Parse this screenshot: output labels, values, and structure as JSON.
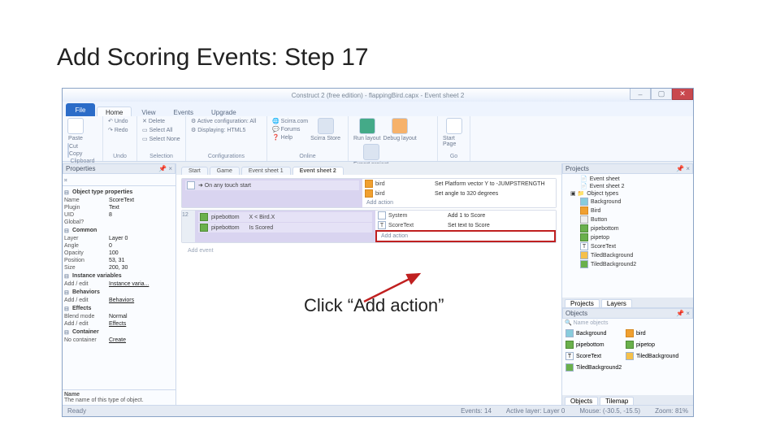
{
  "slide": {
    "title": "Add Scoring Events: Step 17",
    "annotation": "Click “Add action”"
  },
  "window": {
    "title": "Construct 2 (free edition) - flappingBird.capx - Event sheet 2",
    "file_btn": "File",
    "tabs": [
      "Home",
      "View",
      "Events",
      "Upgrade"
    ],
    "active_tab": "Home"
  },
  "ribbon": {
    "clipboard": {
      "label": "Clipboard",
      "paste": "Paste",
      "cut": "Cut",
      "copy": "Copy"
    },
    "undo": {
      "label": "Undo",
      "undo": "Undo",
      "redo": "Redo"
    },
    "selection": {
      "label": "Selection",
      "del": "Delete",
      "all": "Select All",
      "none": "Select None"
    },
    "config": {
      "label": "Configurations",
      "active": "Active configuration: All",
      "display": "Displaying: HTML5"
    },
    "online": {
      "label": "Online",
      "a": "Scirra.com",
      "b": "Forums",
      "c": "Help",
      "store": "Scirra Store"
    },
    "run": {
      "run": "Run layout",
      "debug": "Debug layout",
      "export": "Export project"
    },
    "go": {
      "label": "Go",
      "start": "Start Page"
    }
  },
  "panels": {
    "properties": {
      "title": "Properties",
      "search": "𝄪"
    },
    "projects": {
      "title": "Projects"
    },
    "layers_title": "Objects",
    "projects_tab": "Projects",
    "layers_tab": "Layers",
    "objects_tab": "Objects",
    "tilemap_tab": "Tilemap",
    "name_objects": "Name objects"
  },
  "props": {
    "sections": {
      "type": "Object type properties",
      "common": "Common",
      "instance": "Instance variables",
      "behaviors": "Behaviors",
      "effects": "Effects",
      "container": "Container"
    },
    "rows": {
      "name_k": "Name",
      "name_v": "ScoreText",
      "plugin_k": "Plugin",
      "plugin_v": "Text",
      "uid_k": "UID",
      "uid_v": "8",
      "global_k": "Global?",
      "layer_k": "Layer",
      "layer_v": "Layer 0",
      "angle_k": "Angle",
      "angle_v": "0",
      "opacity_k": "Opacity",
      "opacity_v": "100",
      "pos_k": "Position",
      "pos_v": "53, 31",
      "size_k": "Size",
      "size_v": "200, 30",
      "ivar": "Add / edit",
      "ivar_v": "Instance varia...",
      "beh": "Add / edit",
      "beh_v": "Behaviors",
      "blend_k": "Blend mode",
      "blend_v": "Normal",
      "eff": "Add / edit",
      "eff_v": "Effects",
      "cont": "No container",
      "cont_v": "Create"
    },
    "desc_title": "Name",
    "desc_body": "The name of this type of object."
  },
  "center": {
    "tabs": [
      "Start",
      "Game",
      "Event sheet 1",
      "Event sheet 2"
    ],
    "active_tab": "Event sheet 2",
    "ev1_cond": "➜ On any touch start",
    "ev1_a1_obj": "bird",
    "ev1_a1_txt": "Set Platform vector Y to -JUMPSTRENGTH",
    "ev1_a2_obj": "bird",
    "ev1_a2_txt": "Set angle to 320 degrees",
    "ev2_num": "12",
    "ev2_c1_obj": "pipebottom",
    "ev2_c1_txt": "X < Bird.X",
    "ev2_c2_obj": "pipebottom",
    "ev2_c2_txt": "Is Scored",
    "ev2_a1_obj": "System",
    "ev2_a1_txt": "Add 1 to Score",
    "ev2_a2_obj": "ScoreText",
    "ev2_a2_txt": "Set text to Score",
    "add_action": "Add action",
    "add_event": "Add event"
  },
  "tree": {
    "es1": "Event sheet",
    "es2": "Event sheet 2",
    "ot": "Object types",
    "items": [
      "Background",
      "Bird",
      "Button",
      "pipebottom",
      "pipetop",
      "ScoreText",
      "TiledBackground",
      "TiledBackground2"
    ]
  },
  "layers": {
    "items": [
      "Background",
      "bird",
      "pipebottom",
      "pipetop",
      "ScoreText",
      "TiledBackground",
      "TiledBackground2"
    ]
  },
  "status": {
    "ready": "Ready",
    "ev": "Events: 14",
    "layer": "Active layer: Layer 0",
    "mouse": "Mouse: (-30.5, -15.5)",
    "zoom": "Zoom: 81%"
  }
}
